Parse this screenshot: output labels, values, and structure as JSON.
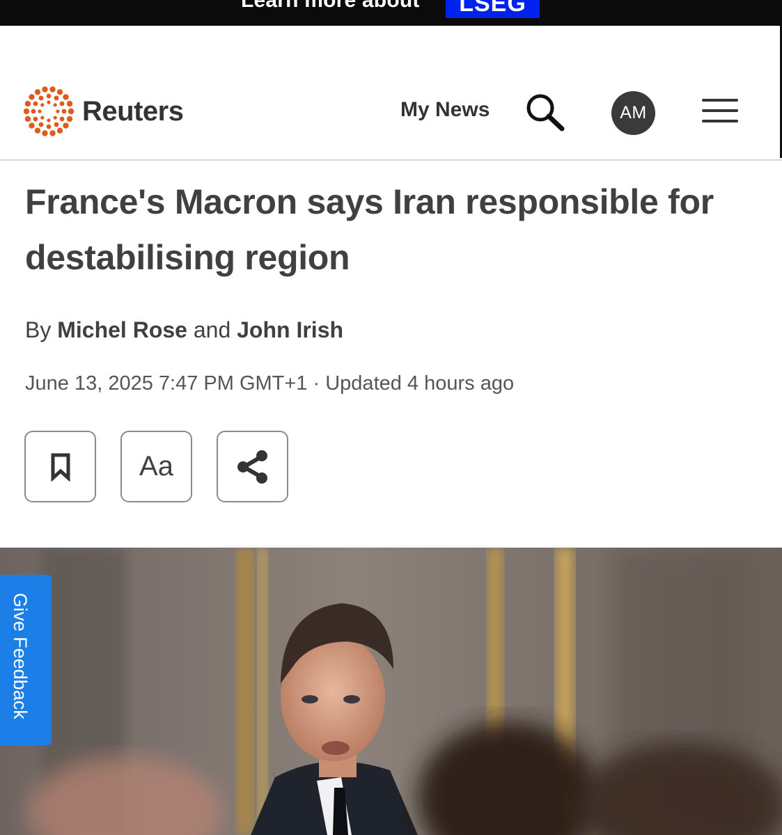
{
  "promo_banner": {
    "text": "Learn more about",
    "brand": "LSEG"
  },
  "header": {
    "logo_text": "Reuters",
    "my_news_label": "My News",
    "avatar_initials": "AM",
    "icons": {
      "search": "search-icon",
      "menu": "hamburger-menu-icon",
      "logo": "reuters-dot-circle-icon"
    },
    "brand_color": "#e05a1e"
  },
  "article": {
    "headline": "France's Macron says Iran responsible for destabilising region",
    "byline": {
      "prefix": "By",
      "author_1": "Michel Rose",
      "joiner": "and",
      "author_2": "John Irish"
    },
    "date": "June 13, 2025 7:47 PM GMT+1",
    "separator": "·",
    "updated": "Updated 4 hours ago",
    "tools": {
      "bookmark_icon": "bookmark-icon",
      "text_size_label": "Aa",
      "share_icon": "share-icon"
    }
  },
  "feedback_tab": {
    "label": "Give Feedback",
    "color": "#1c7fe8"
  }
}
